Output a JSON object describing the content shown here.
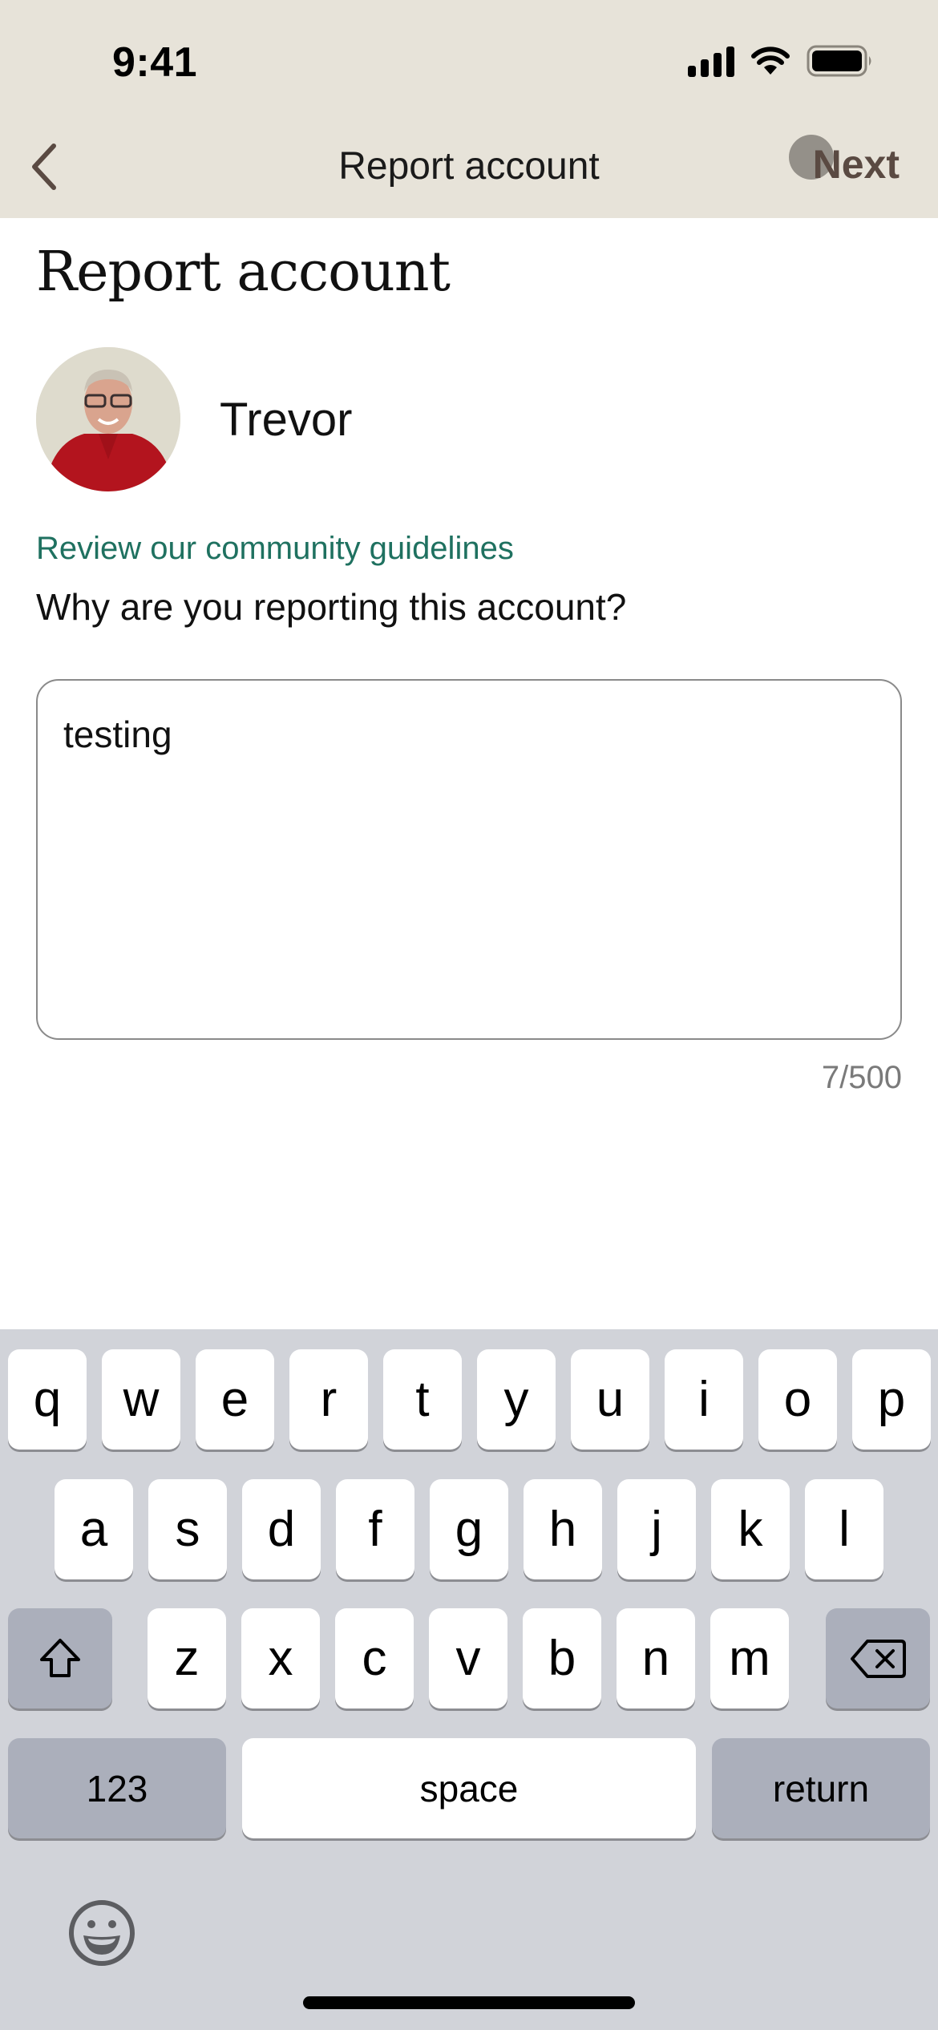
{
  "status_bar": {
    "time": "9:41"
  },
  "nav": {
    "title": "Report account",
    "back_label": "Back",
    "next_label": "Next"
  },
  "page": {
    "heading": "Report account",
    "user": {
      "name": "Trevor"
    },
    "guidelines_link": "Review our community guidelines",
    "question": "Why are you reporting this account?",
    "reason_input": {
      "value": "testing",
      "char_count": "7/500"
    }
  },
  "keyboard": {
    "row1": [
      "q",
      "w",
      "e",
      "r",
      "t",
      "y",
      "u",
      "i",
      "o",
      "p"
    ],
    "row2": [
      "a",
      "s",
      "d",
      "f",
      "g",
      "h",
      "j",
      "k",
      "l"
    ],
    "row3": [
      "z",
      "x",
      "c",
      "v",
      "b",
      "n",
      "m"
    ],
    "numbers_label": "123",
    "space_label": "space",
    "return_label": "return"
  },
  "colors": {
    "nav_bg": "#e7e3d9",
    "link": "#1f7160",
    "next": "#5a4a42",
    "keyboard_bg": "#d1d3d9"
  }
}
